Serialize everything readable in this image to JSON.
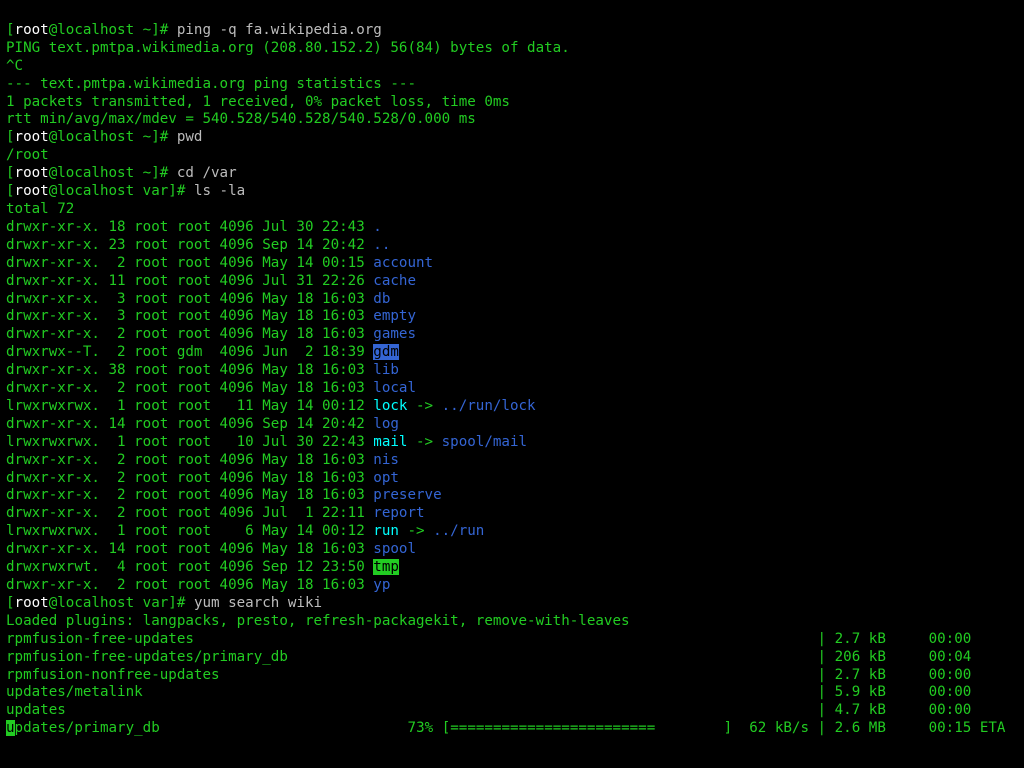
{
  "prompt": {
    "open": "[",
    "user": "root",
    "at": "@",
    "host": "localhost",
    "dir_home": " ~",
    "dir_var": " var",
    "close": "]",
    "hash": "# "
  },
  "cmds": {
    "ping": "ping -q fa.wikipedia.org",
    "pwd": "pwd",
    "cd": "cd /var",
    "ls": "ls -la",
    "yum": "yum search wiki"
  },
  "ping": {
    "l1": "PING text.pmtpa.wikimedia.org (208.80.152.2) 56(84) bytes of data.",
    "l2": "^C",
    "l3": "",
    "l4": "--- text.pmtpa.wikimedia.org ping statistics ---",
    "l5": "1 packets transmitted, 1 received, 0% packet loss, time 0ms",
    "l6": "rtt min/avg/max/mdev = 540.528/540.528/540.528/0.000 ms"
  },
  "pwd_out": "/root",
  "ls_total": "total 72",
  "ls_rows": [
    {
      "perm": "drwxr-xr-x. 18 root root 4096 Jul 30 22:43 ",
      "name": ".",
      "cls": "c-blue"
    },
    {
      "perm": "drwxr-xr-x. 23 root root 4096 Sep 14 20:42 ",
      "name": "..",
      "cls": "c-blue"
    },
    {
      "perm": "drwxr-xr-x.  2 root root 4096 May 14 00:15 ",
      "name": "account",
      "cls": "c-blue"
    },
    {
      "perm": "drwxr-xr-x. 11 root root 4096 Jul 31 22:26 ",
      "name": "cache",
      "cls": "c-blue"
    },
    {
      "perm": "drwxr-xr-x.  3 root root 4096 May 18 16:03 ",
      "name": "db",
      "cls": "c-blue"
    },
    {
      "perm": "drwxr-xr-x.  3 root root 4096 May 18 16:03 ",
      "name": "empty",
      "cls": "c-blue"
    },
    {
      "perm": "drwxr-xr-x.  2 root root 4096 May 18 16:03 ",
      "name": "games",
      "cls": "c-blue"
    },
    {
      "perm": "drwxrwx--T.  2 root gdm  4096 Jun  2 18:39 ",
      "name": "gdm",
      "cls": "sel-blue"
    },
    {
      "perm": "drwxr-xr-x. 38 root root 4096 May 18 16:03 ",
      "name": "lib",
      "cls": "c-blue"
    },
    {
      "perm": "drwxr-xr-x.  2 root root 4096 May 18 16:03 ",
      "name": "local",
      "cls": "c-blue"
    },
    {
      "perm": "lrwxrwxrwx.  1 root root   11 May 14 00:12 ",
      "name": "lock",
      "cls": "c-brcyan",
      "arrow": " -> ",
      "target": "../run/lock",
      "tcls": "c-blue"
    },
    {
      "perm": "drwxr-xr-x. 14 root root 4096 Sep 14 20:42 ",
      "name": "log",
      "cls": "c-blue"
    },
    {
      "perm": "lrwxrwxrwx.  1 root root   10 Jul 30 22:43 ",
      "name": "mail",
      "cls": "c-brcyan",
      "arrow": " -> ",
      "target": "spool/mail",
      "tcls": "c-blue"
    },
    {
      "perm": "drwxr-xr-x.  2 root root 4096 May 18 16:03 ",
      "name": "nis",
      "cls": "c-blue"
    },
    {
      "perm": "drwxr-xr-x.  2 root root 4096 May 18 16:03 ",
      "name": "opt",
      "cls": "c-blue"
    },
    {
      "perm": "drwxr-xr-x.  2 root root 4096 May 18 16:03 ",
      "name": "preserve",
      "cls": "c-blue"
    },
    {
      "perm": "drwxr-xr-x.  2 root root 4096 Jul  1 22:11 ",
      "name": "report",
      "cls": "c-blue"
    },
    {
      "perm": "lrwxrwxrwx.  1 root root    6 May 14 00:12 ",
      "name": "run",
      "cls": "c-brcyan",
      "arrow": " -> ",
      "target": "../run",
      "tcls": "c-blue"
    },
    {
      "perm": "drwxr-xr-x. 14 root root 4096 May 18 16:03 ",
      "name": "spool",
      "cls": "c-blue"
    },
    {
      "perm": "drwxrwxrwt.  4 root root 4096 Sep 12 23:50 ",
      "name": "tmp",
      "cls": "sel-green"
    },
    {
      "perm": "drwxr-xr-x.  2 root root 4096 May 18 16:03 ",
      "name": "yp",
      "cls": "c-blue"
    }
  ],
  "yum": {
    "plugins": "Loaded plugins: langpacks, presto, refresh-packagekit, remove-with-leaves",
    "repos": [
      {
        "name": "rpmfusion-free-updates",
        "meta": "| 2.7 kB     00:00     "
      },
      {
        "name": "rpmfusion-free-updates/primary_db",
        "meta": "| 206 kB     00:04     "
      },
      {
        "name": "rpmfusion-nonfree-updates",
        "meta": "| 2.7 kB     00:00     "
      },
      {
        "name": "updates/metalink",
        "meta": "| 5.9 kB     00:00     "
      },
      {
        "name": "updates",
        "meta": "| 4.7 kB     00:00     "
      }
    ],
    "pbar": {
      "name_first": "u",
      "name_rest": "pdates/primary_db",
      "pct": "73% ",
      "bar_open": "[",
      "bar_fill": "========================        ",
      "bar_close": "] ",
      "rate": " 62 kB/s",
      "sep": " | ",
      "size": "2.6 MB",
      "eta": "     00:15 ",
      "eta_lbl": "ETA "
    }
  }
}
